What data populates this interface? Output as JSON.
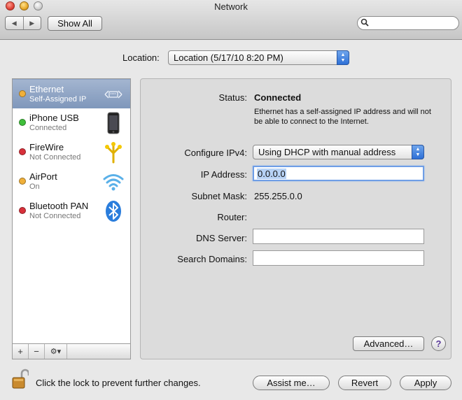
{
  "window": {
    "title": "Network"
  },
  "toolbar": {
    "back_glyph": "◀",
    "forward_glyph": "▶",
    "show_all_label": "Show All",
    "search_placeholder": "",
    "search_icon": "magnifier-icon"
  },
  "location": {
    "label": "Location:",
    "value": "Location (5/17/10 8:20 PM)"
  },
  "sidebar": {
    "services": [
      {
        "name": "Ethernet",
        "status": "Self-Assigned IP",
        "dot_color": "#f0b03a",
        "icon": "ethernet-icon",
        "selected": true
      },
      {
        "name": "iPhone USB",
        "status": "Connected",
        "dot_color": "#3fbf3a",
        "icon": "iphone-icon",
        "selected": false
      },
      {
        "name": "FireWire",
        "status": "Not Connected",
        "dot_color": "#d8303a",
        "icon": "firewire-icon",
        "selected": false
      },
      {
        "name": "AirPort",
        "status": "On",
        "dot_color": "#f0b03a",
        "icon": "wifi-icon",
        "selected": false
      },
      {
        "name": "Bluetooth PAN",
        "status": "Not Connected",
        "dot_color": "#d8303a",
        "icon": "bluetooth-icon",
        "selected": false
      }
    ],
    "add_label": "+",
    "remove_label": "−",
    "gear_label": "⚙▾"
  },
  "detail": {
    "status_label": "Status:",
    "status_value": "Connected",
    "status_description": "Ethernet has a self-assigned IP address and will not be able to connect to the Internet.",
    "configure_label": "Configure IPv4:",
    "configure_value": "Using DHCP with manual address",
    "ip_label": "IP Address:",
    "ip_value": "0.0.0.0",
    "subnet_label": "Subnet Mask:",
    "subnet_value": "255.255.0.0",
    "router_label": "Router:",
    "router_value": "",
    "dns_label": "DNS Server:",
    "dns_value": "",
    "search_domains_label": "Search Domains:",
    "search_domains_value": "",
    "advanced_label": "Advanced…",
    "help_label": "?"
  },
  "footer": {
    "lock_text": "Click the lock to prevent further changes.",
    "assist_label": "Assist me…",
    "revert_label": "Revert",
    "apply_label": "Apply"
  },
  "colors": {
    "selection": "#8ea3c4",
    "popup_accent": "#2d6fd6",
    "status_amber": "#f0b03a",
    "status_green": "#3fbf3a",
    "status_red": "#d8303a"
  }
}
